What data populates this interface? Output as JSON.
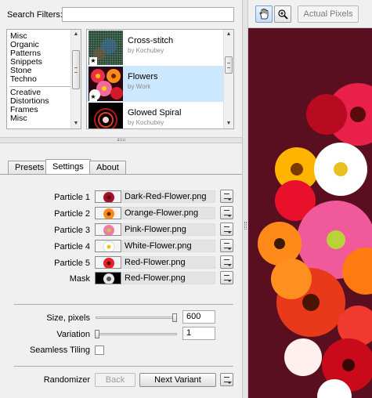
{
  "search": {
    "label": "Search Filters:",
    "value": ""
  },
  "categories": {
    "group1": [
      "Misc",
      "Organic",
      "Patterns",
      "Snippets",
      "Stone",
      "Techno"
    ],
    "group2": [
      "Creative",
      "Distortions",
      "Frames",
      "Misc"
    ]
  },
  "filters": [
    {
      "name": "Cross-stitch",
      "author": "by Kochubey",
      "selected": false
    },
    {
      "name": "Flowers",
      "author": "by Work",
      "selected": true
    },
    {
      "name": "Glowed Spiral",
      "author": "by Kochubey",
      "selected": false
    }
  ],
  "tabs": [
    {
      "label": "Presets",
      "active": false
    },
    {
      "label": "Settings",
      "active": true
    },
    {
      "label": "About",
      "active": false
    }
  ],
  "particles": [
    {
      "label": "Particle 1",
      "file": "Dark-Red-Flower.png"
    },
    {
      "label": "Particle 2",
      "file": "Orange-Flower.png"
    },
    {
      "label": "Particle 3",
      "file": "Pink-Flower.png"
    },
    {
      "label": "Particle 4",
      "file": "White-Flower.png"
    },
    {
      "label": "Particle 5",
      "file": "Red-Flower.png"
    },
    {
      "label": "Mask",
      "file": "Red-Flower.png"
    }
  ],
  "size": {
    "label": "Size, pixels",
    "value": "600",
    "level": 1.0
  },
  "variation": {
    "label": "Variation",
    "value": "1",
    "level": 0.0
  },
  "seamless": {
    "label": "Seamless Tiling",
    "checked": false
  },
  "randomizer": {
    "label": "Randomizer",
    "back": "Back",
    "next": "Next Variant"
  },
  "toolbar": {
    "actual_pixels": "Actual Pixels",
    "hand_icon": "hand-icon",
    "zoom_icon": "zoom-icon"
  },
  "colors": {
    "canvas_bg": "#5a0f20",
    "selected_row": "#cce8ff"
  }
}
